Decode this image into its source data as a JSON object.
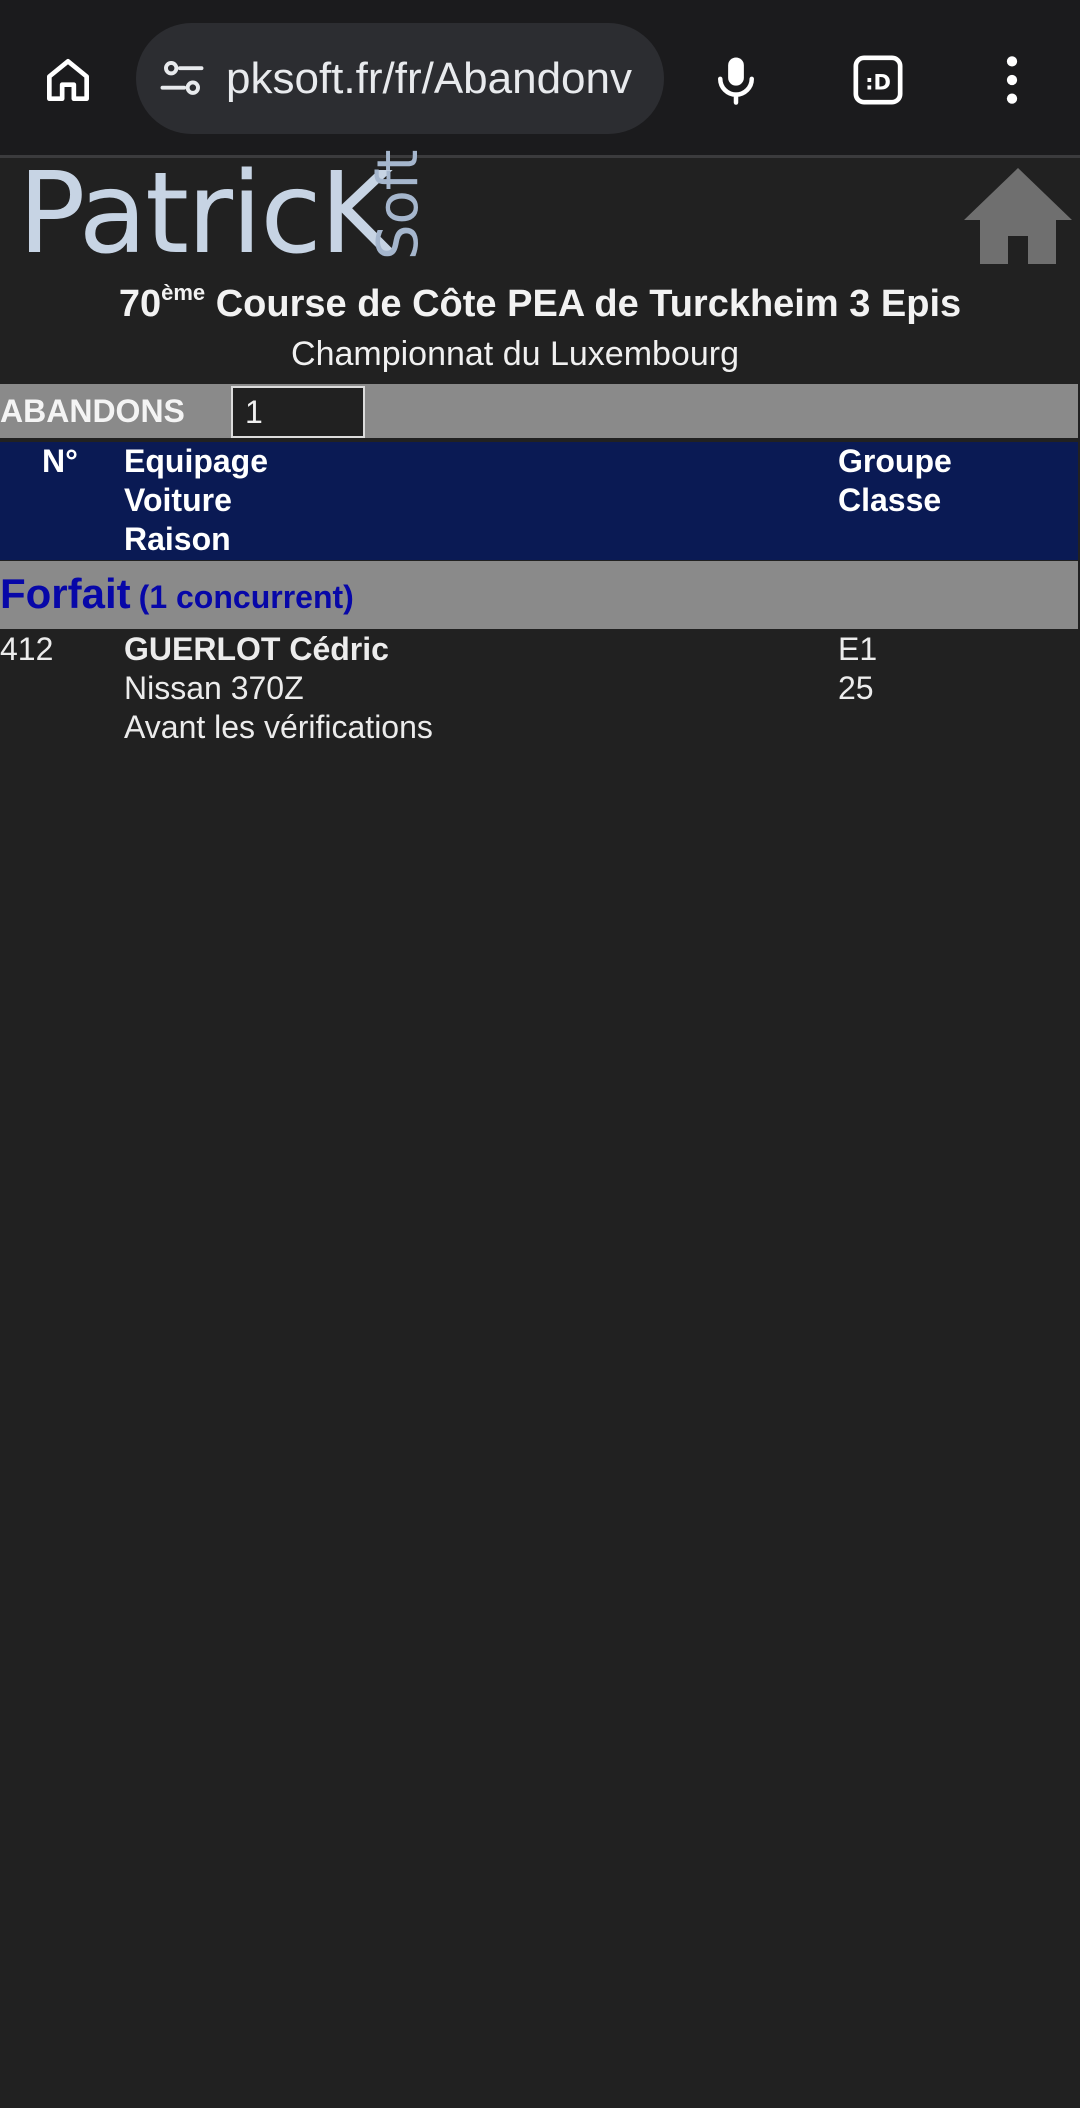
{
  "browser": {
    "url": "pksoft.fr/fr/Abandonv",
    "icons": {
      "home": "home-icon",
      "site_settings": "tune-icon",
      "mic": "microphone-icon",
      "tabs": "tab-switcher-icon",
      "menu": "more-vert-icon"
    },
    "tab_switcher_label": ":D"
  },
  "logo": {
    "main": "PatricK",
    "sub": "Soft"
  },
  "event": {
    "number": "70",
    "ordinal_suffix": "ème",
    "title_rest": " Course de Côte PEA de Turckheim 3 Epis",
    "championship": "Championnat du Luxembourg"
  },
  "abandons": {
    "label": "ABANDONS",
    "count": "1"
  },
  "table": {
    "headers": {
      "number": "N°",
      "team": [
        "Equipage",
        "Voiture",
        "Raison"
      ],
      "group": [
        "Groupe",
        "Classe"
      ]
    }
  },
  "sections": [
    {
      "title": "Forfait",
      "count_text": "(1 concurrent)",
      "entries": [
        {
          "number": "412",
          "driver": "GUERLOT Cédric",
          "car": "Nissan 370Z",
          "reason": "Avant les vérifications",
          "group": "E1",
          "class": "25"
        }
      ]
    }
  ],
  "colors": {
    "page_bg": "#212121",
    "header_bg": "#0a1a54",
    "bar_bg": "#8a8a8a",
    "section_title": "#0707a8",
    "logo": "#c7d4e4"
  }
}
